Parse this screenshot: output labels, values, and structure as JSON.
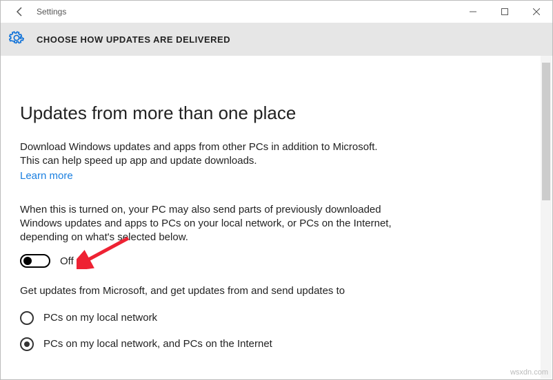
{
  "titlebar": {
    "app_title": "Settings"
  },
  "subheader": {
    "title": "CHOOSE HOW UPDATES ARE DELIVERED"
  },
  "content": {
    "page_title": "Updates from more than one place",
    "description1": "Download Windows updates and apps from other PCs in addition to Microsoft. This can help speed up app and update downloads.",
    "learn_more": "Learn more",
    "description2": "When this is turned on, your PC may also send parts of previously downloaded Windows updates and apps to PCs on your local network, or PCs on the Internet, depending on what's selected below.",
    "toggle": {
      "state_label": "Off"
    },
    "block3_text": "Get updates from Microsoft, and get updates from and send updates to",
    "options": [
      {
        "label": "PCs on my local network",
        "selected": false
      },
      {
        "label": "PCs on my local network, and PCs on the Internet",
        "selected": true
      }
    ]
  },
  "watermark": "wsxdn.com"
}
